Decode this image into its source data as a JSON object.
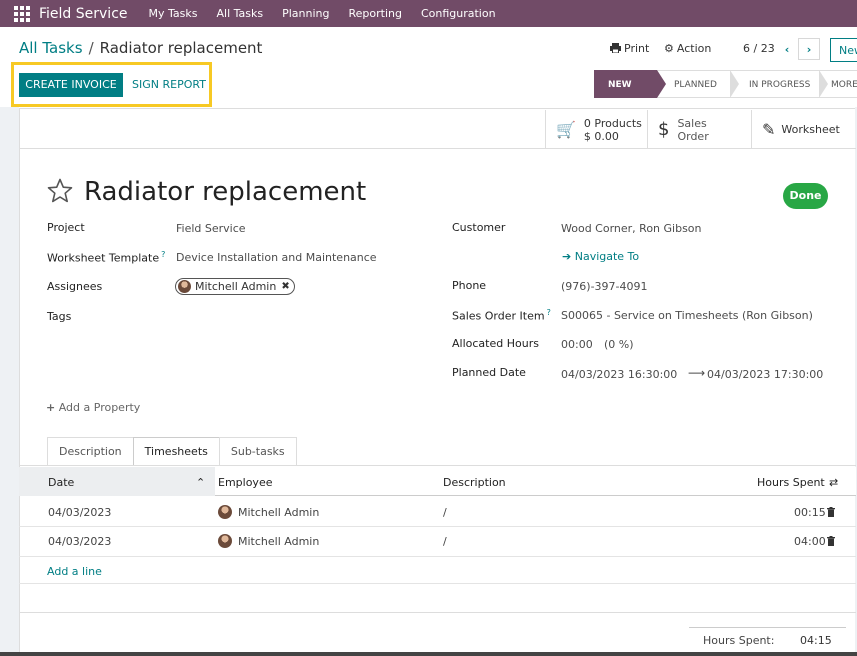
{
  "nav": {
    "brand": "Field Service",
    "menu": [
      "My Tasks",
      "All Tasks",
      "Planning",
      "Reporting",
      "Configuration"
    ]
  },
  "breadcrumb": {
    "parent": "All Tasks",
    "sep": "/",
    "current": "Radiator replacement"
  },
  "toolbar": {
    "print": "Print",
    "action": "Action",
    "pager": "6 / 23",
    "new": "New"
  },
  "buttons": {
    "create_invoice": "CREATE INVOICE",
    "sign_report": "SIGN REPORT"
  },
  "stages": [
    "NEW",
    "PLANNED",
    "IN PROGRESS",
    "MORE"
  ],
  "smart": {
    "products_count": "0 Products",
    "products_amount": "$ 0.00",
    "sales_line1": "Sales",
    "sales_line2": "Order",
    "worksheet": "Worksheet"
  },
  "task": {
    "title": "Radiator replacement",
    "status": "Done"
  },
  "left_fields": {
    "project_label": "Project",
    "project_value": "Field Service",
    "worksheet_label": "Worksheet Template",
    "worksheet_value": "Device Installation and Maintenance",
    "assignees_label": "Assignees",
    "assignee": "Mitchell Admin",
    "tags_label": "Tags"
  },
  "right_fields": {
    "customer_label": "Customer",
    "customer_value": "Wood Corner, Ron Gibson",
    "navigate": "Navigate To",
    "phone_label": "Phone",
    "phone_value": "(976)-397-4091",
    "soi_label": "Sales Order Item",
    "soi_value": "S00065 - Service on Timesheets (Ron Gibson)",
    "alloc_label": "Allocated Hours",
    "alloc_value": "00:00",
    "alloc_pct": "(0 %)",
    "planned_label": "Planned Date",
    "planned_start": "04/03/2023 16:30:00",
    "planned_end": "04/03/2023 17:30:00"
  },
  "add_property": "Add a Property",
  "tabs": [
    "Description",
    "Timesheets",
    "Sub-tasks"
  ],
  "table": {
    "headers": {
      "date": "Date",
      "employee": "Employee",
      "description": "Description",
      "hours": "Hours Spent"
    },
    "rows": [
      {
        "date": "04/03/2023",
        "employee": "Mitchell Admin",
        "description": "/",
        "hours": "00:15"
      },
      {
        "date": "04/03/2023",
        "employee": "Mitchell Admin",
        "description": "/",
        "hours": "04:00"
      }
    ],
    "add_line": "Add a line"
  },
  "summary": {
    "label": "Hours Spent:",
    "value": "04:15"
  },
  "colors": {
    "brand": "#714b67",
    "accent": "#017e84",
    "done": "#28a745",
    "highlight": "#f7c924"
  }
}
